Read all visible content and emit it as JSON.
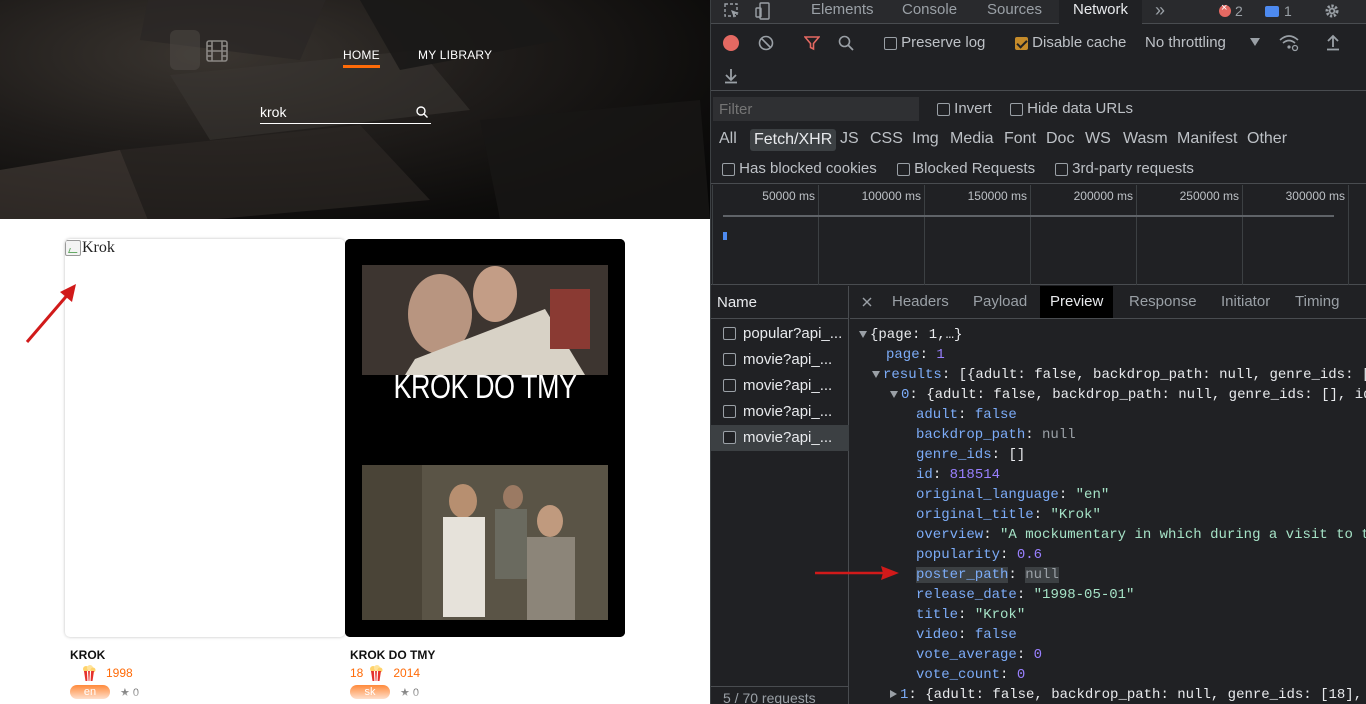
{
  "header": {
    "nav_home": "HOME",
    "nav_library": "MY LIBRARY",
    "search_value": "krok"
  },
  "movies": [
    {
      "poster_alt": "Krok",
      "title": "KROK",
      "genres": "",
      "year": "1998",
      "language": "en",
      "vote": "0"
    },
    {
      "poster_title": "KROK DO TMY",
      "title": "KROK DO TMY",
      "genres": "18",
      "year": "2014",
      "language": "sk",
      "vote": "0"
    }
  ],
  "devtools": {
    "tabs": [
      "Elements",
      "Console",
      "Sources",
      "Network"
    ],
    "more": "»",
    "error_count": "2",
    "message_count": "1",
    "toolbar": {
      "preserve_log": "Preserve log",
      "disable_cache": "Disable cache",
      "throttling": "No throttling"
    },
    "filter_placeholder": "Filter",
    "invert": "Invert",
    "hide_data_urls": "Hide data URLs",
    "types": [
      "All",
      "Fetch/XHR",
      "JS",
      "CSS",
      "Img",
      "Media",
      "Font",
      "Doc",
      "WS",
      "Wasm",
      "Manifest",
      "Other"
    ],
    "blocked_cookies": "Has blocked cookies",
    "blocked_requests": "Blocked Requests",
    "third_party": "3rd-party requests",
    "timeline_labels": [
      "50000 ms",
      "100000 ms",
      "150000 ms",
      "200000 ms",
      "250000 ms",
      "300000 ms"
    ],
    "name_header": "Name",
    "requests": [
      "popular?api_...",
      "movie?api_...",
      "movie?api_...",
      "movie?api_...",
      "movie?api_..."
    ],
    "status": "5 / 70 requests",
    "detail_tabs": [
      "Headers",
      "Payload",
      "Preview",
      "Response",
      "Initiator",
      "Timing"
    ],
    "preview": {
      "root": "{page: 1,…}",
      "page_key": "page",
      "page_val": "1",
      "results_key": "results",
      "results_summary": "[{adult: false, backdrop_path: null, genre_ids: [",
      "item0_key": "0",
      "item0_summary": "{adult: false, backdrop_path: null, genre_ids: [], id",
      "fields": [
        {
          "k": "adult",
          "v": "false",
          "t": "k"
        },
        {
          "k": "backdrop_path",
          "v": "null",
          "t": "nl"
        },
        {
          "k": "genre_ids",
          "v": "[]",
          "t": "p"
        },
        {
          "k": "id",
          "v": "818514",
          "t": "n"
        },
        {
          "k": "original_language",
          "v": "\"en\"",
          "t": "s"
        },
        {
          "k": "original_title",
          "v": "\"Krok\"",
          "t": "s"
        },
        {
          "k": "overview",
          "v": "\"A mockumentary in which during a visit to th",
          "t": "s"
        },
        {
          "k": "popularity",
          "v": "0.6",
          "t": "n"
        },
        {
          "k": "poster_path",
          "v": "null",
          "t": "nl"
        },
        {
          "k": "release_date",
          "v": "\"1998-05-01\"",
          "t": "s"
        },
        {
          "k": "title",
          "v": "\"Krok\"",
          "t": "s"
        },
        {
          "k": "video",
          "v": "false",
          "t": "k"
        },
        {
          "k": "vote_average",
          "v": "0",
          "t": "n"
        },
        {
          "k": "vote_count",
          "v": "0",
          "t": "n"
        }
      ],
      "item1_key": "1",
      "item1_summary": "{adult: false, backdrop_path: null, genre_ids: [18],"
    }
  },
  "colors": {
    "accent": "#ff6b08",
    "annotation_arrow": "#d11a1a"
  }
}
